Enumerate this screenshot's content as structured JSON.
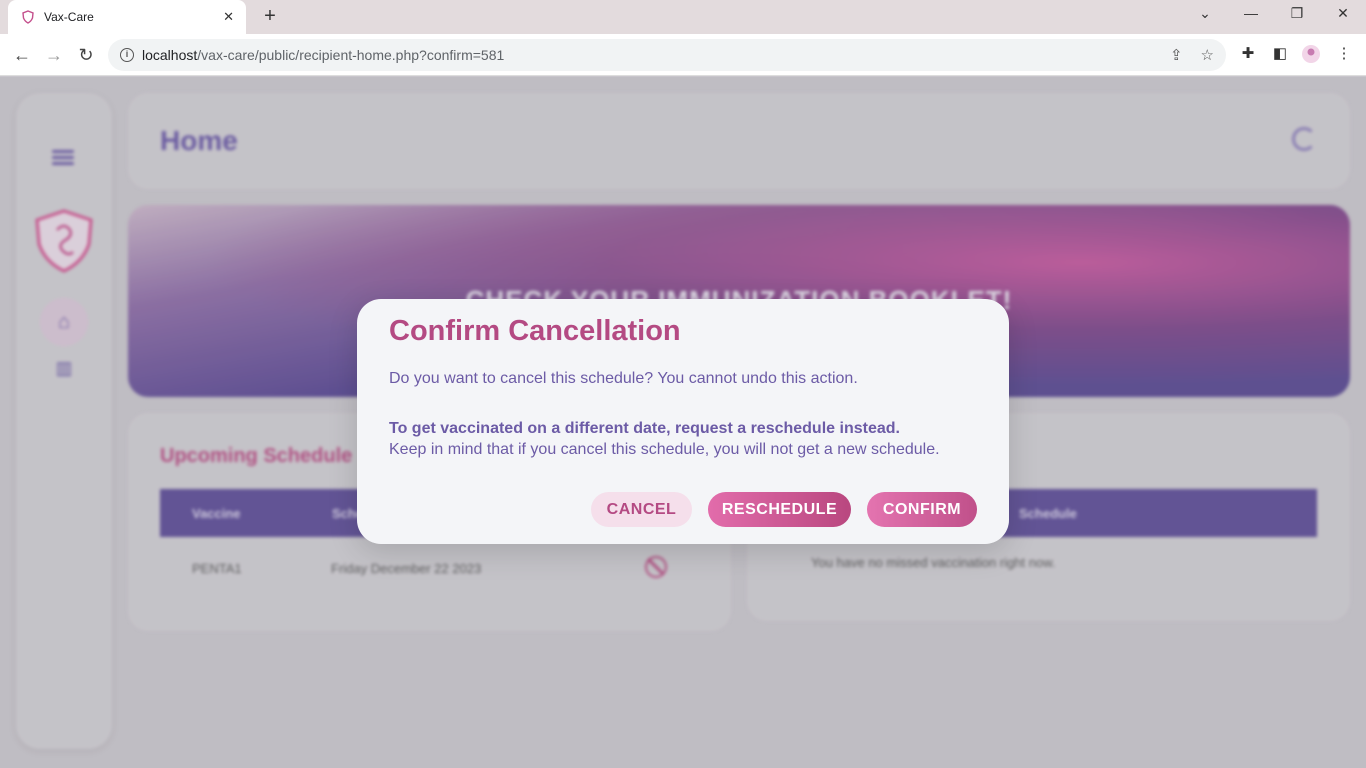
{
  "browser": {
    "tab_title": "Vax-Care",
    "tab_close": "✕",
    "new_tab": "+",
    "url_host": "localhost",
    "url_path": "/vax-care/public/recipient-home.php?confirm=581"
  },
  "header": {
    "title": "Home"
  },
  "banner": {
    "text": "CHECK YOUR IMMUNIZATION BOOKLET!"
  },
  "upcoming": {
    "title": "Upcoming Schedule",
    "columns": [
      "Vaccine",
      "Schedule"
    ],
    "rows": [
      {
        "vaccine": "PENTA1",
        "schedule": "Friday December 22 2023"
      }
    ]
  },
  "missed": {
    "columns": [
      "Schedule"
    ],
    "empty_message": "You have no missed vaccination right now."
  },
  "modal": {
    "title": "Confirm Cancellation",
    "message": "Do you want to cancel this schedule? You cannot undo this action.",
    "bold_note": "To get vaccinated on a different date, request a reschedule instead.",
    "note": "Keep in mind that if you cancel this schedule, you will not get a new schedule.",
    "cancel_label": "CANCEL",
    "reschedule_label": "RESCHEDULE",
    "confirm_label": "CONFIRM"
  },
  "colors": {
    "brand_purple": "#6c5ba6",
    "brand_pink": "#b44a83"
  }
}
